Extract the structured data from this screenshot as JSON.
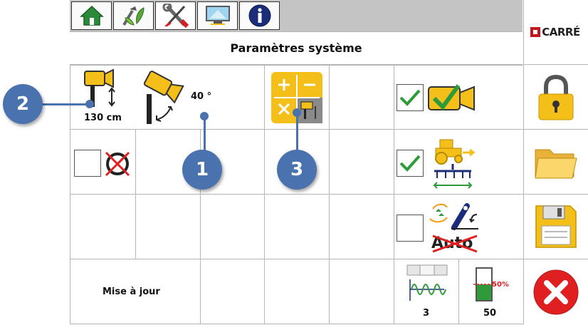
{
  "header": {
    "title": "Paramètres système",
    "tabs": [
      {
        "name": "home-tab",
        "icon": "home-icon"
      },
      {
        "name": "agronomy-tab",
        "icon": "plant-tools-icon"
      },
      {
        "name": "settings-tab",
        "icon": "wrench-screwdriver-icon",
        "active": true
      },
      {
        "name": "display-tab",
        "icon": "monitor-icon"
      },
      {
        "name": "info-tab",
        "icon": "info-icon"
      }
    ],
    "brand": "CARRÉ"
  },
  "cells": {
    "camera_height": "130 cm",
    "camera_angle": "40 °",
    "update": "Mise à jour",
    "sensitivity_value": "3",
    "threshold_value": "50",
    "threshold_percent": "50%",
    "auto_label": "Auto"
  },
  "checkboxes": {
    "speed_sensor_disabled": false,
    "camera_enabled": true,
    "tractor_implement": true,
    "auto_mode": false
  },
  "callouts": [
    "1",
    "2",
    "3"
  ],
  "colors": {
    "accent_yellow": "#f5bf1a",
    "check_green": "#2e9a3a",
    "callout_blue": "#4a72ae",
    "close_red": "#e02020"
  }
}
